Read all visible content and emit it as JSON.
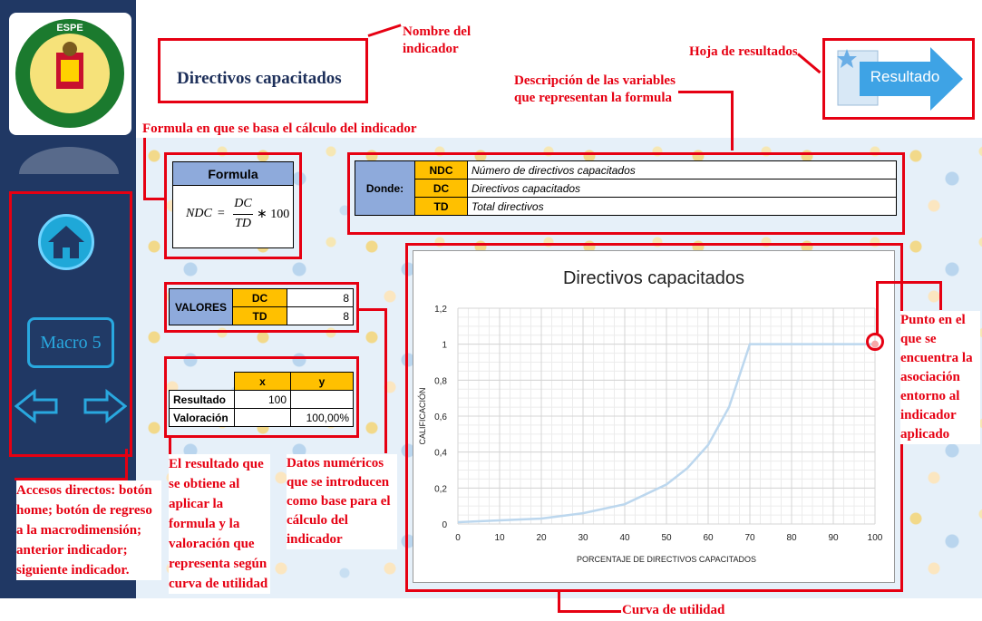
{
  "header": {
    "indicator_title": "Directivos capacitados",
    "result_button": "Resultado"
  },
  "sidebar": {
    "macro_label": "Macro 5"
  },
  "formula": {
    "title": "Formula",
    "lhs": "NDC",
    "num": "DC",
    "den": "TD",
    "rhs": "∗ 100"
  },
  "definitions": {
    "label": "Donde:",
    "rows": [
      {
        "code": "NDC",
        "desc": "Número de directivos capacitados"
      },
      {
        "code": "DC",
        "desc": "Directivos capacitados"
      },
      {
        "code": "TD",
        "desc": "Total directivos"
      }
    ]
  },
  "valores": {
    "label": "VALORES",
    "rows": [
      {
        "code": "DC",
        "value": "8"
      },
      {
        "code": "TD",
        "value": "8"
      }
    ]
  },
  "results": {
    "col_x": "x",
    "col_y": "y",
    "row1_label": "Resultado",
    "row1_x": "100",
    "row1_y": "",
    "row2_label": "Valoración",
    "row2_x": "",
    "row2_y": "100,00%"
  },
  "annotations": {
    "nombre": "Nombre del indicador",
    "hoja": "Hoja de resultados",
    "descripcion": "Descripción de las variables que representan la formula",
    "formula_base": "Formula en que se basa el cálculo del indicador",
    "accesos": "Accesos directos: botón home; botón de regreso a la macrodimensión; anterior indicador; siguiente indicador.",
    "resultado": "El resultado que se obtiene al aplicar la formula y la valoración que representa según curva de utilidad",
    "datos": "Datos numéricos que se introducen como base para el cálculo del indicador",
    "punto": "Punto en el que se encuentra la asociación entorno al indicador aplicado",
    "curva": "Curva de utilidad"
  },
  "colors": {
    "sidebar": "#203864",
    "accent_red": "#e60012",
    "gold": "#ffc000",
    "blue_header": "#8eaadb",
    "curve": "#bcd7ee"
  },
  "chart_data": {
    "type": "line",
    "title": "Directivos capacitados",
    "xlabel": "PORCENTAJE DE DIRECTIVOS CAPACITADOS",
    "ylabel": "CALIFICACIÓN",
    "xlim": [
      0,
      100
    ],
    "ylim": [
      0,
      1.2
    ],
    "x_ticks": [
      "0",
      "10",
      "20",
      "30",
      "40",
      "50",
      "60",
      "70",
      "80",
      "90",
      "100"
    ],
    "y_ticks": [
      "0",
      "0,2",
      "0,4",
      "0,6",
      "0,8",
      "1",
      "1,2"
    ],
    "grid": true,
    "series": [
      {
        "x": [
          0,
          10,
          20,
          30,
          40,
          50,
          55,
          60,
          65,
          70,
          80,
          90,
          100
        ],
        "values": [
          0.01,
          0.02,
          0.03,
          0.06,
          0.11,
          0.22,
          0.31,
          0.44,
          0.65,
          1.0,
          1.0,
          1.0,
          1.0
        ]
      }
    ],
    "highlight_point": {
      "x": 100,
      "y": 1.0
    }
  }
}
